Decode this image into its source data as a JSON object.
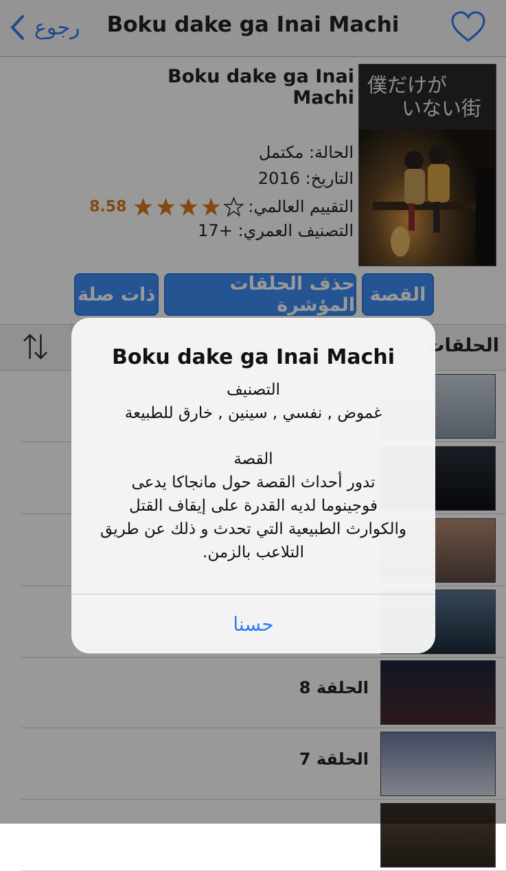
{
  "nav": {
    "back_label": "رجوع",
    "title": "Boku dake ga Inai Machi"
  },
  "anime": {
    "title": "Boku dake ga Inai Machi",
    "poster_text_line1": "僕だけが",
    "poster_text_line2": "いない街",
    "status": "الحالة: مكتمل",
    "date": "التاريخ: 2016",
    "rating_label": "التقييم العالمي:",
    "rating_value": "8.58",
    "rating_stars": 4,
    "age_rating": "التصنيف العمري: +17"
  },
  "buttons": {
    "story": "القصة",
    "delete_marked": "حذف الحلقات المؤشرة",
    "related": "ذات صلة"
  },
  "episodes": {
    "header": "الحلقات",
    "items": [
      {
        "label": ""
      },
      {
        "label": ""
      },
      {
        "label": ""
      },
      {
        "label": ""
      },
      {
        "label": "الحلقة 8"
      },
      {
        "label": "الحلقة 7"
      }
    ]
  },
  "alert": {
    "title": "Boku dake ga Inai Machi",
    "genre_heading": "التصنيف",
    "genres": "غموض , نفسي , سينين , خارق للطبيعة",
    "story_heading": "القصة",
    "story_line1": "تدور أحداث القصة حول مانجاكا يدعى",
    "story_line2": "فوجينوما لديه القدرة على إيقاف القتل",
    "story_line3": "والكوارث الطبيعية التي تحدث و ذلك عن طريق",
    "story_line4": "التلاعب بالزمن.",
    "ok_label": "حسنا"
  },
  "colors": {
    "accent": "#2f7bf6",
    "button_bg": "#3f8cf3",
    "rating": "#d97b1e"
  }
}
